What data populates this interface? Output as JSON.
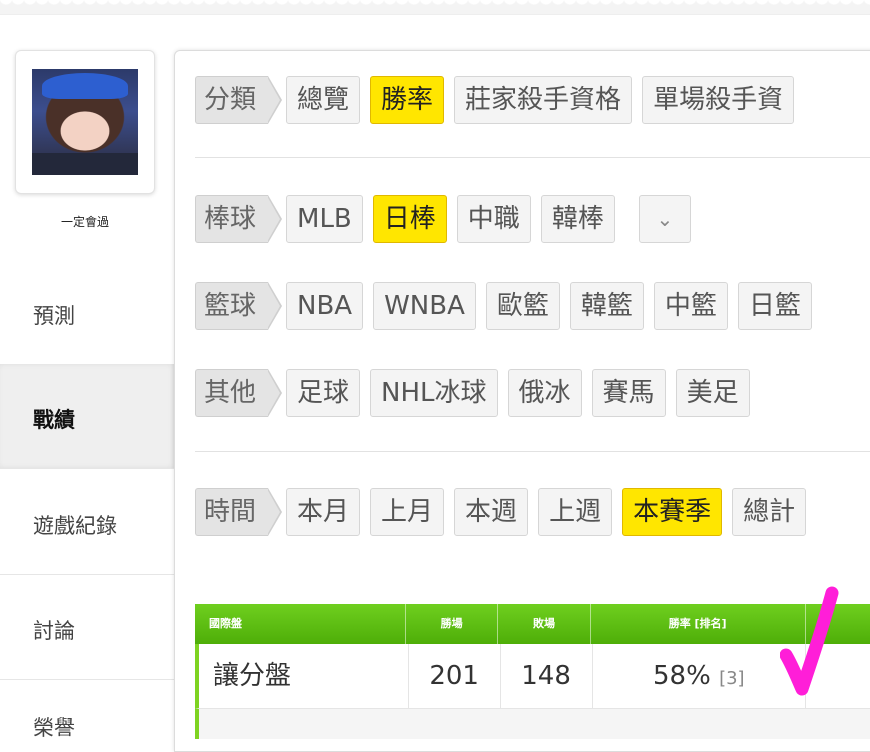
{
  "user": {
    "name": "一定會過"
  },
  "nav": {
    "items": [
      {
        "label": "預測"
      },
      {
        "label": "戰績"
      },
      {
        "label": "遊戲紀錄"
      },
      {
        "label": "討論"
      },
      {
        "label": "榮譽"
      }
    ]
  },
  "filters": {
    "category": {
      "label": "分類",
      "options": [
        "總覽",
        "勝率",
        "莊家殺手資格",
        "單場殺手資"
      ]
    },
    "baseball": {
      "label": "棒球",
      "options": [
        "MLB",
        "日棒",
        "中職",
        "韓棒"
      ]
    },
    "basketball": {
      "label": "籃球",
      "options": [
        "NBA",
        "WNBA",
        "歐籃",
        "韓籃",
        "中籃",
        "日籃"
      ]
    },
    "other": {
      "label": "其他",
      "options": [
        "足球",
        "NHL冰球",
        "俄冰",
        "賽馬",
        "美足"
      ]
    },
    "time": {
      "label": "時間",
      "options": [
        "本月",
        "上月",
        "本週",
        "上週",
        "本賽季",
        "總計"
      ]
    }
  },
  "table": {
    "headers": [
      "國際盤",
      "勝場",
      "敗場",
      "勝率 [排名]"
    ],
    "rows": [
      {
        "type": "讓分盤",
        "wins": "201",
        "losses": "148",
        "rate": "58%",
        "rank": "[3]"
      }
    ]
  },
  "colors": {
    "accent_yellow": "#ffe600",
    "header_green": "#5cbf0f",
    "annotation_magenta": "#ff1ed8"
  }
}
